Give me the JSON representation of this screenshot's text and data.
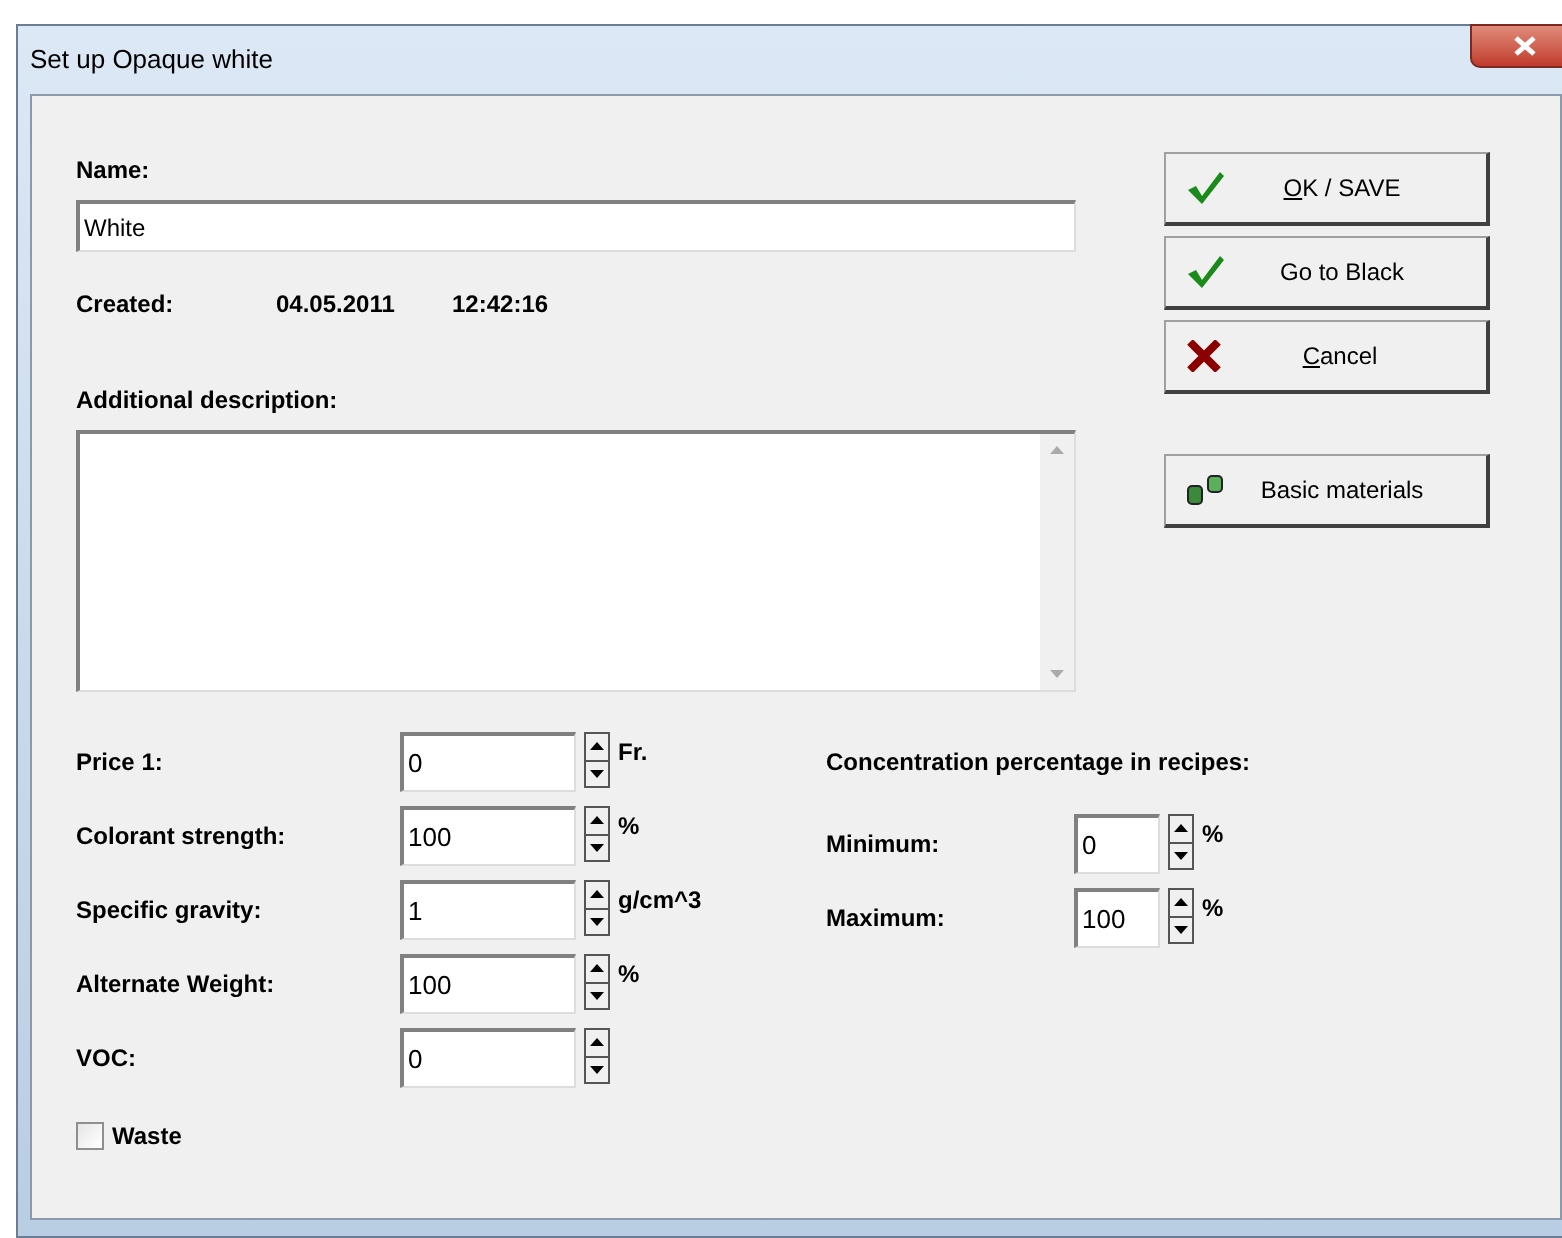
{
  "window": {
    "title": "Set up Opaque white"
  },
  "name": {
    "label": "Name:",
    "value": "White"
  },
  "created": {
    "label": "Created:",
    "date": "04.05.2011",
    "time": "12:42:16"
  },
  "description": {
    "label": "Additional description:"
  },
  "buttons": [
    {
      "label": "OK / SAVE",
      "kind": "check",
      "mnemonic": true
    },
    {
      "label": "Go to Black",
      "kind": "check",
      "mnemonic": false
    },
    {
      "label": "Cancel",
      "kind": "cross",
      "mnemonic": true
    },
    {
      "label": "Basic materials",
      "kind": "cans",
      "mnemonic": false
    }
  ],
  "properties": [
    {
      "label": "Price 1:",
      "value": "0",
      "unit": "Fr."
    },
    {
      "label": "Colorant strength:",
      "value": "100",
      "unit": "%"
    },
    {
      "label": "Specific gravity:",
      "value": "1",
      "unit": "g/cm^3"
    },
    {
      "label": "Alternate Weight:",
      "value": "100",
      "unit": "%"
    },
    {
      "label": "VOC:",
      "value": "0"
    }
  ],
  "waste": {
    "label": "Waste",
    "checked": false
  },
  "concentration": {
    "title": "Concentration percentage in recipes:",
    "limits": [
      {
        "label": "Minimum:",
        "value": "0",
        "unit": "%"
      },
      {
        "label": "Maximum:",
        "value": "100",
        "unit": "%"
      }
    ]
  }
}
